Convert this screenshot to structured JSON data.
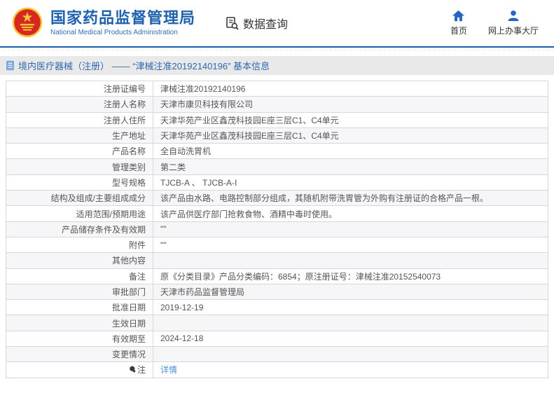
{
  "header": {
    "agency_name_cn": "国家药品监督管理局",
    "agency_name_en": "National Medical Products Administration",
    "data_query_label": "数据查询",
    "nav": [
      {
        "label": "首页",
        "icon": "home-icon"
      },
      {
        "label": "网上办事大厅",
        "icon": "person-icon"
      }
    ]
  },
  "breadcrumb": {
    "icon": "document-icon",
    "text": "境内医疗器械（注册） —— “津械注准20192140196” 基本信息"
  },
  "table": {
    "rows": [
      {
        "label": "注册证编号",
        "value": "津械注准20192140196"
      },
      {
        "label": "注册人名称",
        "value": "天津市康贝科技有限公司"
      },
      {
        "label": "注册人住所",
        "value": "天津华苑产业区鑫茂科技园E座三层C1、C4单元"
      },
      {
        "label": "生产地址",
        "value": "天津华苑产业区鑫茂科技园E座三层C1、C4单元"
      },
      {
        "label": "产品名称",
        "value": "全自动洗胃机"
      },
      {
        "label": "管理类别",
        "value": "第二类"
      },
      {
        "label": "型号规格",
        "value": "TJCB-A 、 TJCB-A-I"
      },
      {
        "label": "结构及组成/主要组成成分",
        "value": "该产品由水路、电路控制部分组成，其随机附带洗胃管为外购有注册证的合格产品一根。"
      },
      {
        "label": "适用范围/预期用途",
        "value": "该产品供医疗部门抢救食物、酒精中毒时使用。"
      },
      {
        "label": "产品储存条件及有效期",
        "value": "\"\""
      },
      {
        "label": "附件",
        "value": "\"\""
      },
      {
        "label": "其他内容",
        "value": ""
      },
      {
        "label": "备注",
        "value": "原《分类目录》产品分类编码：6854；原注册证号：津械注准20152540073"
      },
      {
        "label": "审批部门",
        "value": "天津市药品监督管理局"
      },
      {
        "label": "批准日期",
        "value": "2019-12-19"
      },
      {
        "label": "生效日期",
        "value": ""
      },
      {
        "label": "有效期至",
        "value": "2024-12-18"
      },
      {
        "label": "变更情况",
        "value": ""
      },
      {
        "label": "注",
        "label_icon": "bulb-icon",
        "value": "详情",
        "value_is_link": "true"
      }
    ]
  },
  "colors": {
    "brand_blue": "#1e62af",
    "header_divider_blue": "#1b5fad",
    "link_blue": "#4a90d9",
    "emblem_red": "#d6281f",
    "emblem_gold": "#f5c53a",
    "breadcrumb_bg": "#e9e9e9"
  }
}
